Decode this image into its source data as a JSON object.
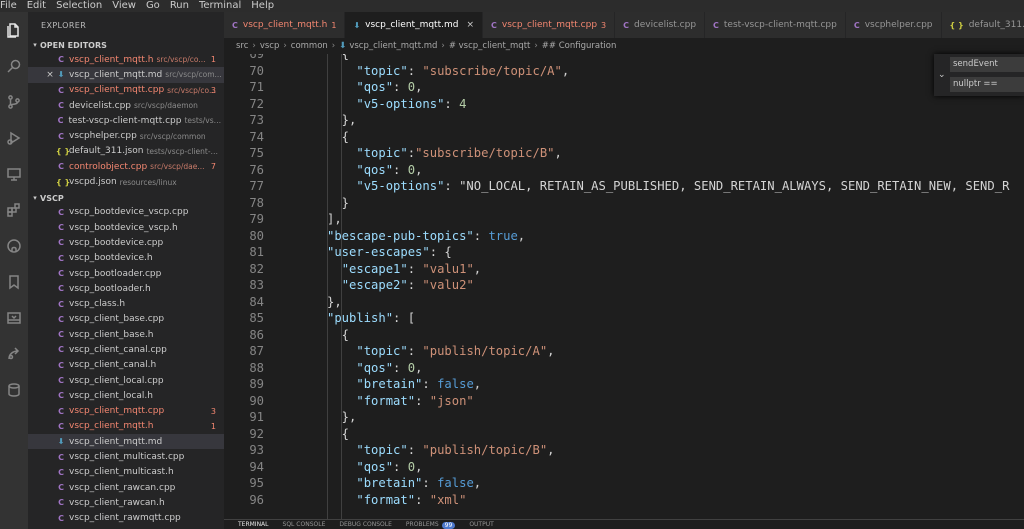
{
  "menu": [
    "File",
    "Edit",
    "Selection",
    "View",
    "Go",
    "Run",
    "Terminal",
    "Help"
  ],
  "sidebar": {
    "title": "EXPLORER",
    "open_editors_label": "OPEN EDITORS",
    "open_editors": [
      {
        "icon": "C",
        "name": "vscp_client_mqtt.h",
        "path": "src/vscp/co...",
        "badge": "1",
        "err": true
      },
      {
        "icon": "md",
        "name": "vscp_client_mqtt.md",
        "path": "src/vscp/com...",
        "badge": "",
        "err": false,
        "close": "×",
        "selected": true
      },
      {
        "icon": "C",
        "name": "vscp_client_mqtt.cpp",
        "path": "src/vscp/co...",
        "badge": "3",
        "err": true
      },
      {
        "icon": "cpp",
        "name": "devicelist.cpp",
        "path": "src/vscp/daemon",
        "badge": "",
        "err": false
      },
      {
        "icon": "cpp",
        "name": "test-vscp-client-mqtt.cpp",
        "path": "tests/vsc...",
        "badge": "",
        "err": false
      },
      {
        "icon": "cpp",
        "name": "vscphelper.cpp",
        "path": "src/vscp/common",
        "badge": "",
        "err": false
      },
      {
        "icon": "json",
        "name": "default_311.json",
        "path": "tests/vscp-client-m...",
        "badge": "",
        "err": false
      },
      {
        "icon": "C",
        "name": "controlobject.cpp",
        "path": "src/vscp/dae...",
        "badge": "7",
        "err": true
      },
      {
        "icon": "json",
        "name": "vscpd.json",
        "path": "resources/linux",
        "badge": "",
        "err": false
      }
    ],
    "folder_label": "VSCP",
    "files": [
      {
        "icon": "C",
        "name": "vscp_bootdevice_vscp.cpp",
        "badge": "",
        "err": false
      },
      {
        "icon": "C",
        "name": "vscp_bootdevice_vscp.h",
        "badge": "",
        "err": false
      },
      {
        "icon": "C",
        "name": "vscp_bootdevice.cpp",
        "badge": "",
        "err": false
      },
      {
        "icon": "C",
        "name": "vscp_bootdevice.h",
        "badge": "",
        "err": false
      },
      {
        "icon": "C",
        "name": "vscp_bootloader.cpp",
        "badge": "",
        "err": false
      },
      {
        "icon": "C",
        "name": "vscp_bootloader.h",
        "badge": "",
        "err": false
      },
      {
        "icon": "C",
        "name": "vscp_class.h",
        "badge": "",
        "err": false
      },
      {
        "icon": "C",
        "name": "vscp_client_base.cpp",
        "badge": "",
        "err": false
      },
      {
        "icon": "C",
        "name": "vscp_client_base.h",
        "badge": "",
        "err": false
      },
      {
        "icon": "C",
        "name": "vscp_client_canal.cpp",
        "badge": "",
        "err": false
      },
      {
        "icon": "C",
        "name": "vscp_client_canal.h",
        "badge": "",
        "err": false
      },
      {
        "icon": "C",
        "name": "vscp_client_local.cpp",
        "badge": "",
        "err": false
      },
      {
        "icon": "C",
        "name": "vscp_client_local.h",
        "badge": "",
        "err": false
      },
      {
        "icon": "C",
        "name": "vscp_client_mqtt.cpp",
        "badge": "3",
        "err": true
      },
      {
        "icon": "C",
        "name": "vscp_client_mqtt.h",
        "badge": "1",
        "err": true
      },
      {
        "icon": "md",
        "name": "vscp_client_mqtt.md",
        "badge": "",
        "err": false,
        "selected": true
      },
      {
        "icon": "C",
        "name": "vscp_client_multicast.cpp",
        "badge": "",
        "err": false
      },
      {
        "icon": "C",
        "name": "vscp_client_multicast.h",
        "badge": "",
        "err": false
      },
      {
        "icon": "C",
        "name": "vscp_client_rawcan.cpp",
        "badge": "",
        "err": false
      },
      {
        "icon": "C",
        "name": "vscp_client_rawcan.h",
        "badge": "",
        "err": false
      },
      {
        "icon": "C",
        "name": "vscp_client_rawmqtt.cpp",
        "badge": "",
        "err": false
      }
    ]
  },
  "tabs": [
    {
      "icon": "C",
      "label": "vscp_client_mqtt.h",
      "num": "1",
      "err": true,
      "active": false
    },
    {
      "icon": "md",
      "label": "vscp_client_mqtt.md",
      "num": "",
      "err": false,
      "active": true,
      "close": "×"
    },
    {
      "icon": "C",
      "label": "vscp_client_mqtt.cpp",
      "num": "3",
      "err": true,
      "active": false
    },
    {
      "icon": "cpp",
      "label": "devicelist.cpp",
      "num": "",
      "err": false,
      "active": false
    },
    {
      "icon": "cpp",
      "label": "test-vscp-client-mqtt.cpp",
      "num": "",
      "err": false,
      "active": false
    },
    {
      "icon": "cpp",
      "label": "vscphelper.cpp",
      "num": "",
      "err": false,
      "active": false
    },
    {
      "icon": "json",
      "label": "default_311.json",
      "num": "",
      "err": false,
      "active": false
    }
  ],
  "breadcrumb": [
    "src",
    "vscp",
    "common",
    "vscp_client_mqtt.md",
    "# vscp_client_mqtt",
    "## Configuration"
  ],
  "find_widget": {
    "find": "sendEvent",
    "replace": "nullptr =="
  },
  "editor": {
    "lines": [
      {
        "n": "69",
        "code": "    {"
      },
      {
        "n": "70",
        "code": "      \"topic\": \"subscribe/topic/A\","
      },
      {
        "n": "71",
        "code": "      \"qos\": 0,"
      },
      {
        "n": "72",
        "code": "      \"v5-options\": 4"
      },
      {
        "n": "73",
        "code": "    },"
      },
      {
        "n": "74",
        "code": "    {"
      },
      {
        "n": "75",
        "code": "      \"topic\":\"subscribe/topic/B\","
      },
      {
        "n": "76",
        "code": "      \"qos\": 0,"
      },
      {
        "n": "77",
        "code": "      \"v5-options\": \"NO_LOCAL, RETAIN_AS_PUBLISHED, SEND_RETAIN_ALWAYS, SEND_RETAIN_NEW, SEND_R"
      },
      {
        "n": "78",
        "code": "    }"
      },
      {
        "n": "79",
        "code": "  ],"
      },
      {
        "n": "80",
        "code": "  \"bescape-pub-topics\": true,"
      },
      {
        "n": "81",
        "code": "  \"user-escapes\": {"
      },
      {
        "n": "82",
        "code": "    \"escape1\": \"valu1\","
      },
      {
        "n": "83",
        "code": "    \"escape2\": \"valu2\""
      },
      {
        "n": "84",
        "code": "  },"
      },
      {
        "n": "85",
        "code": "  \"publish\": ["
      },
      {
        "n": "86",
        "code": "    {"
      },
      {
        "n": "87",
        "code": "      \"topic\": \"publish/topic/A\","
      },
      {
        "n": "88",
        "code": "      \"qos\": 0,"
      },
      {
        "n": "89",
        "code": "      \"bretain\": false,"
      },
      {
        "n": "90",
        "code": "      \"format\": \"json\""
      },
      {
        "n": "91",
        "code": "    },"
      },
      {
        "n": "92",
        "code": "    {"
      },
      {
        "n": "93",
        "code": "      \"topic\": \"publish/topic/B\","
      },
      {
        "n": "94",
        "code": "      \"qos\": 0,"
      },
      {
        "n": "95",
        "code": "      \"bretain\": false,"
      },
      {
        "n": "96",
        "code": "      \"format\": \"xml\""
      }
    ]
  },
  "panel": {
    "tabs": [
      "TERMINAL",
      "SQL CONSOLE",
      "DEBUG CONSOLE",
      "PROBLEMS",
      "OUTPUT"
    ],
    "problems_count": "99"
  },
  "colors": {
    "error": "#f48771",
    "accent": "#007acc",
    "c_icon": "#a074c4",
    "md_icon": "#519aba",
    "json_icon": "#cbcb41"
  },
  "icons": {
    "activity": [
      "files-icon",
      "search-icon",
      "source-control-icon",
      "run-debug-icon",
      "remote-explorer-icon",
      "extensions-icon",
      "github-icon",
      "bookmarks-icon",
      "panel-icon",
      "live-share-icon",
      "database-icon"
    ]
  }
}
